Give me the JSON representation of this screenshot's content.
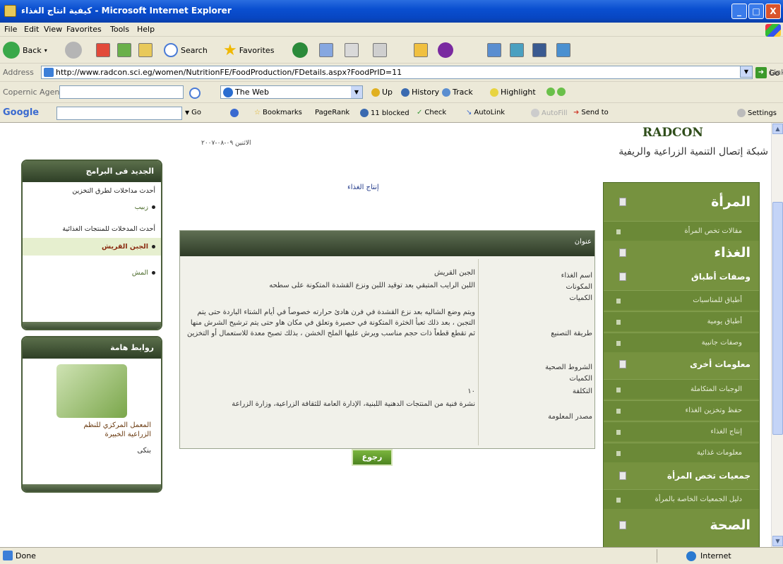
{
  "window": {
    "title": "كيفية انتاج الغذاء - Microsoft Internet Explorer",
    "min": "_",
    "max": "□",
    "close": "X"
  },
  "menu": [
    "File",
    "Edit",
    "View",
    "Favorites",
    "Tools",
    "Help"
  ],
  "toolbar": {
    "back": "Back",
    "search": "Search",
    "favorites": "Favorites"
  },
  "address": {
    "label": "Address",
    "url": "http://www.radcon.sci.eg/women/NutritionFE/FoodProduction/FDetails.aspx?FoodPrID=11",
    "go": "Go",
    "links": "Links"
  },
  "copernic": {
    "label": "Copernic Agent",
    "engine": "The Web",
    "up": "Up",
    "history": "History",
    "track": "Track",
    "highlight": "Highlight"
  },
  "google": {
    "logo": "Google",
    "go": "Go",
    "bookmarks": "Bookmarks",
    "pagerank": "PageRank",
    "blocked": "11 blocked",
    "check": "Check",
    "autolink": "AutoLink",
    "autofill": "AutoFill",
    "sendto": "Send to",
    "settings": "Settings"
  },
  "page": {
    "date": "الاثنين ٠٩-٠٨-٢٠٠٧",
    "brand": "RADCON",
    "brand_sub": "شبكة إتصال التنمية الزراعية والريفية",
    "left_news": {
      "title": "الجديد فى البرامج",
      "items": [
        {
          "text": "أحدث مداخلات لطرق التخزين",
          "kind": "head"
        },
        {
          "text": "زبيب",
          "kind": "sub"
        },
        {
          "text": "أحدث المدخلات للمنتجات الغذائية",
          "kind": "head"
        },
        {
          "text": "الجبن القريش",
          "kind": "hl"
        },
        {
          "text": "المش",
          "kind": "sub"
        }
      ]
    },
    "left_links": {
      "title": "روابط هامة",
      "lines": [
        "المعمل المركزي للنظم",
        "الزراعية الخبيرة"
      ],
      "last": "بنكى"
    },
    "product_link": "إنتاج الغذاء",
    "details": {
      "header": "عنوان",
      "rows": [
        {
          "label": "اسم الغذاء",
          "value": "الجبن القريش"
        },
        {
          "label": "المكونات",
          "value": "اللبن الرايب المتبقي بعد توقيد اللبن ونزع القشدة المتكونة على سطحه"
        },
        {
          "label": "الكميات",
          "value": ""
        },
        {
          "label": "طريقة التصنيع",
          "value": "ويتم وضع الشاليه بعد نزع القشدة في فرن هادئ حرارته خصوصاً في أيام الشتاء الباردة حتى يتم التجبن ، بعد ذلك تعبأ الخثرة المتكونة في حصيرة وتعلق في مكان هاو حتى يتم ترشيح الشرش منها ثم تقطع قطعاً ذات حجم مناسب ويرش عليها الملح الخشن ، بذلك تصبح معدة للاستعمال أو التخزين"
        },
        {
          "label": "الشروط الصحية",
          "value": ""
        },
        {
          "label": "الكميات",
          "value": ""
        },
        {
          "label": "التكلفة",
          "value": "١٠"
        },
        {
          "label": "مصدر المعلومة",
          "value": "نشرة فنية من المنتجات الدهنية اللبنية، الإدارة العامة للثقافة الزراعية، وزارة الزراعة"
        }
      ],
      "back": "رجوع"
    },
    "right_nav": {
      "woman": "المرأة",
      "woman_items": [
        "مقالات تخص المرأة"
      ],
      "food": "الغذاء",
      "dishes": "وصفات أطباق",
      "dish_items": [
        "أطباق للمناسبات",
        "أطباق يومية",
        "وصفات جانبية"
      ],
      "other": "معلومات أخرى",
      "other_items": [
        "الوجبات المتكاملة",
        "حفظ وتخزين الغذاء",
        "إنتاج الغذاء",
        "معلومات غذائية"
      ],
      "assoc": "جمعيات تخص المرأة",
      "assoc_items": [
        "دليل الجمعيات الخاصة بالمرأة"
      ],
      "health": "الصحة"
    }
  },
  "status": {
    "done": "Done",
    "zone": "Internet"
  }
}
